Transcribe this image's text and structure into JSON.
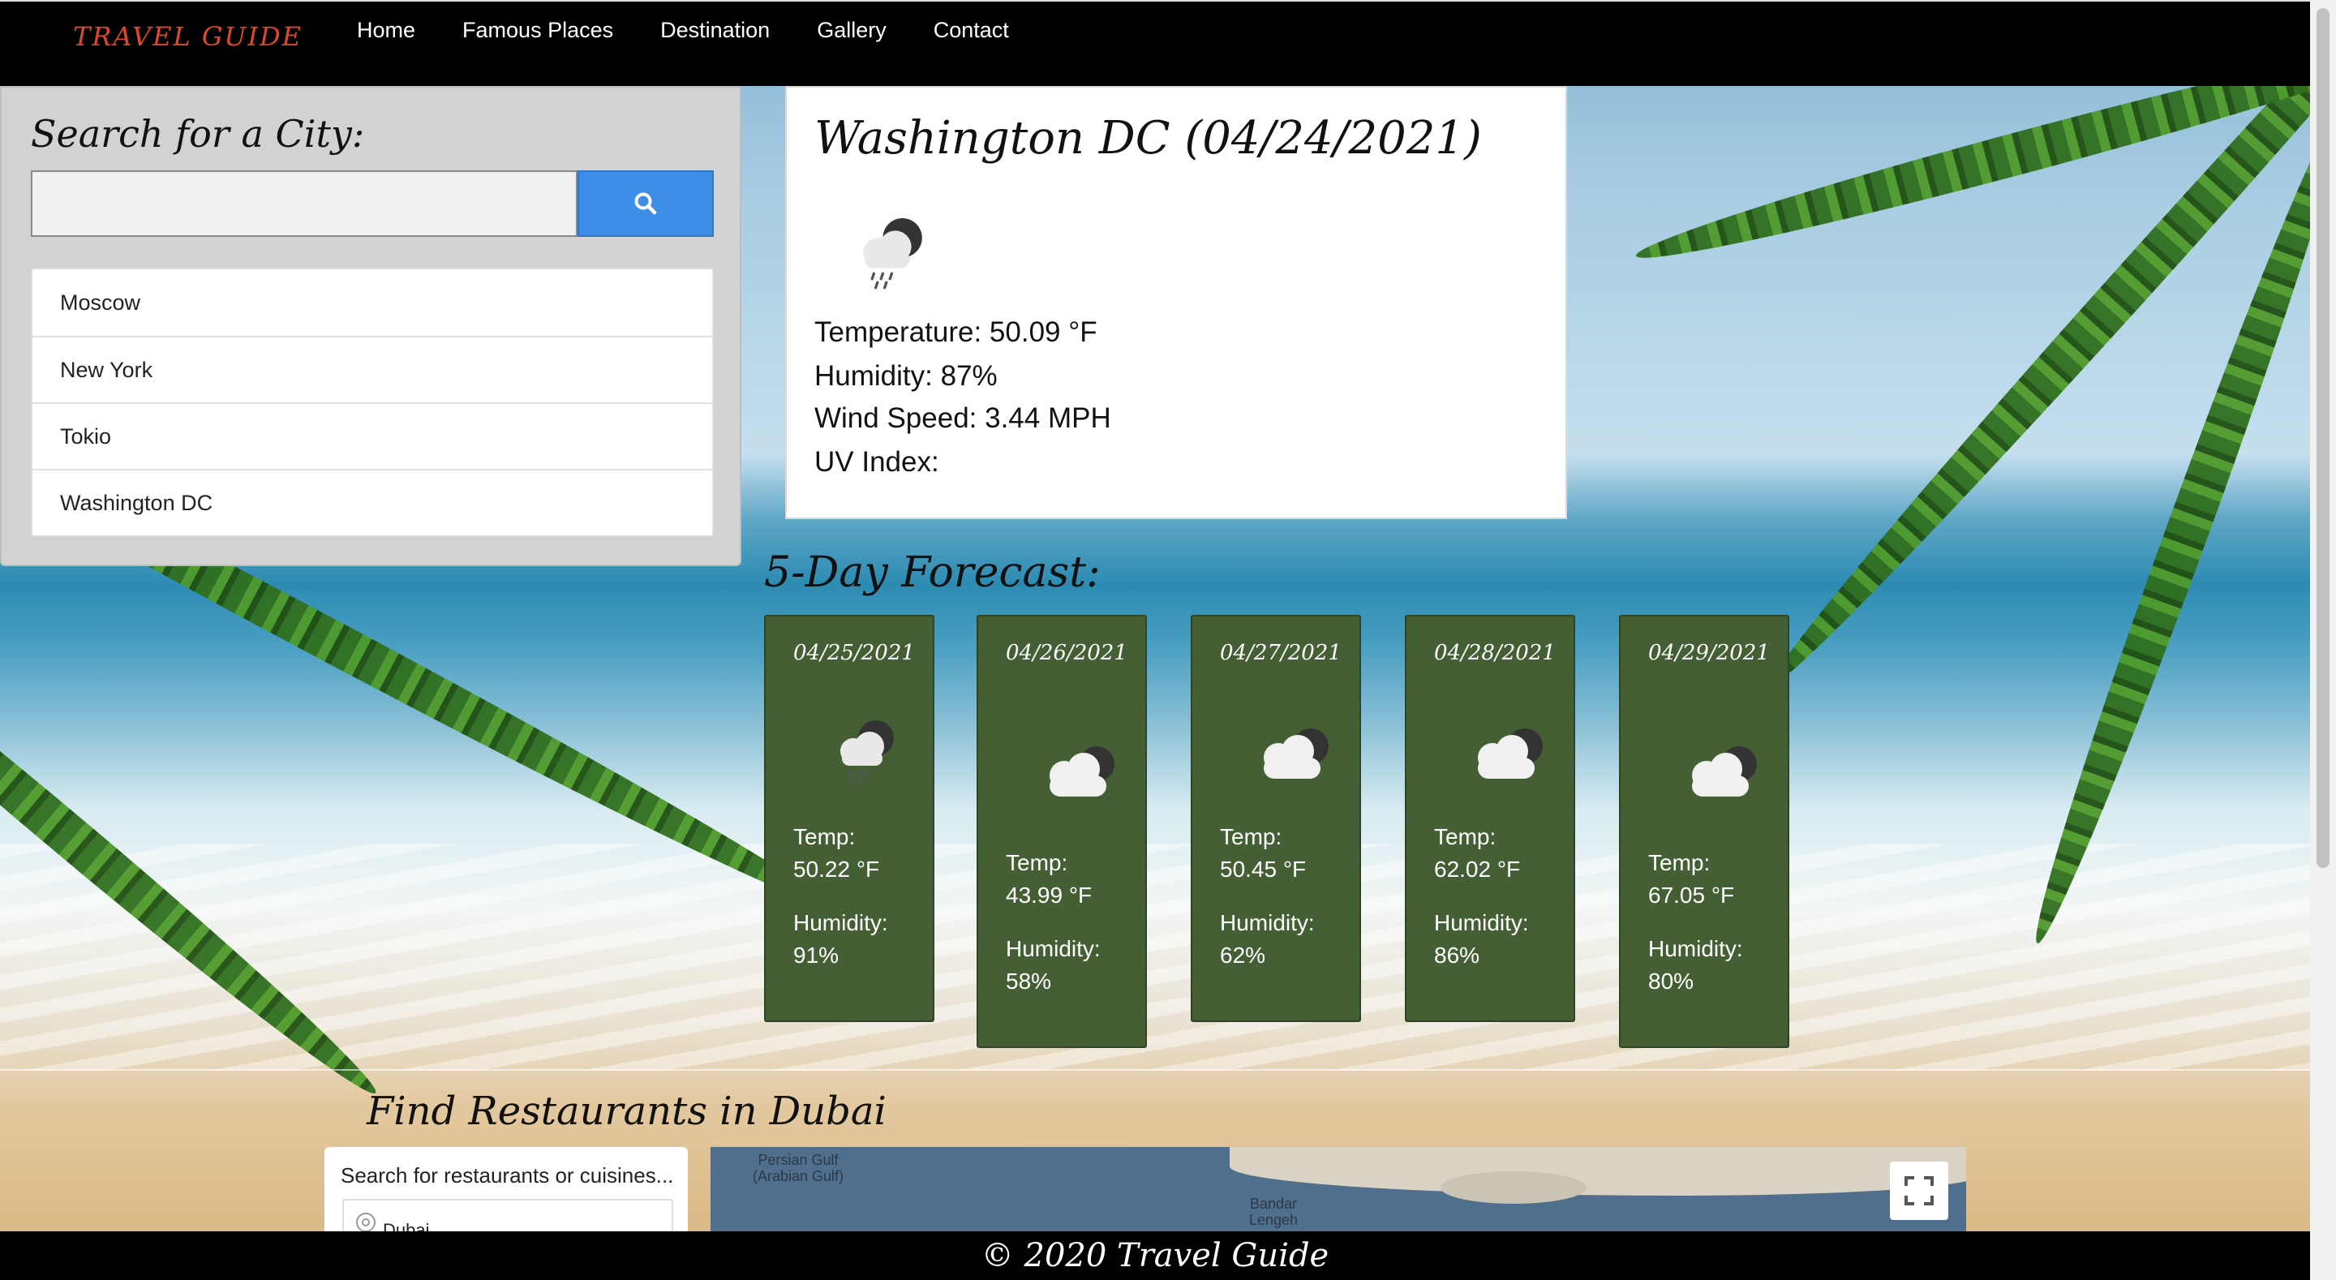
{
  "nav": {
    "brand": "TRAVEL GUIDE",
    "links": [
      "Home",
      "Famous Places",
      "Destination",
      "Gallery",
      "Contact"
    ]
  },
  "search": {
    "title": "Search for a City:",
    "input_value": "",
    "button_icon": "search-icon",
    "cities": [
      "Moscow",
      "New York",
      "Tokio",
      "Washington DC"
    ]
  },
  "current": {
    "title": "Washington DC (04/24/2021)",
    "icon": "rain-cloud-night-icon",
    "temperature": "Temperature: 50.09 °F",
    "humidity": "Humidity: 87%",
    "wind": "Wind Speed: 3.44 MPH",
    "uv": "UV Index:"
  },
  "forecast": {
    "title": "5-Day Forecast:",
    "days": [
      {
        "date": "04/25/2021",
        "icon": "rain-cloud-night-icon",
        "temp_label": "Temp:",
        "temp": "50.22 °F",
        "humidity_label": "Humidity:",
        "humidity": "91%"
      },
      {
        "date": "04/26/2021",
        "icon": "cloud-night-icon",
        "temp_label": "Temp:",
        "temp": "43.99 °F",
        "humidity_label": "Humidity:",
        "humidity": "58%"
      },
      {
        "date": "04/27/2021",
        "icon": "cloud-night-icon",
        "temp_label": "Temp:",
        "temp": "50.45 °F",
        "humidity_label": "Humidity:",
        "humidity": "62%"
      },
      {
        "date": "04/28/2021",
        "icon": "cloud-night-icon",
        "temp_label": "Temp:",
        "temp": "62.02 °F",
        "humidity_label": "Humidity:",
        "humidity": "86%"
      },
      {
        "date": "04/29/2021",
        "icon": "cloud-night-icon",
        "temp_label": "Temp:",
        "temp": "67.05 °F",
        "humidity_label": "Humidity:",
        "humidity": "80%"
      }
    ]
  },
  "restaurants": {
    "title": "Find Restaurants in Dubai",
    "placeholder": "Search for restaurants or cuisines...",
    "location": "Dubai",
    "map_labels": {
      "gulf": "Persian Gulf\n(Arabian Gulf)",
      "port": "Bandar\nLengeh"
    }
  },
  "footer": {
    "text": "© 2020 Travel Guide"
  },
  "colors": {
    "navbar": "#000000",
    "brand": "#e0482b",
    "search_button": "#3d8ee6",
    "forecast_card": "#445f34",
    "panel": "#d2d2d2"
  }
}
